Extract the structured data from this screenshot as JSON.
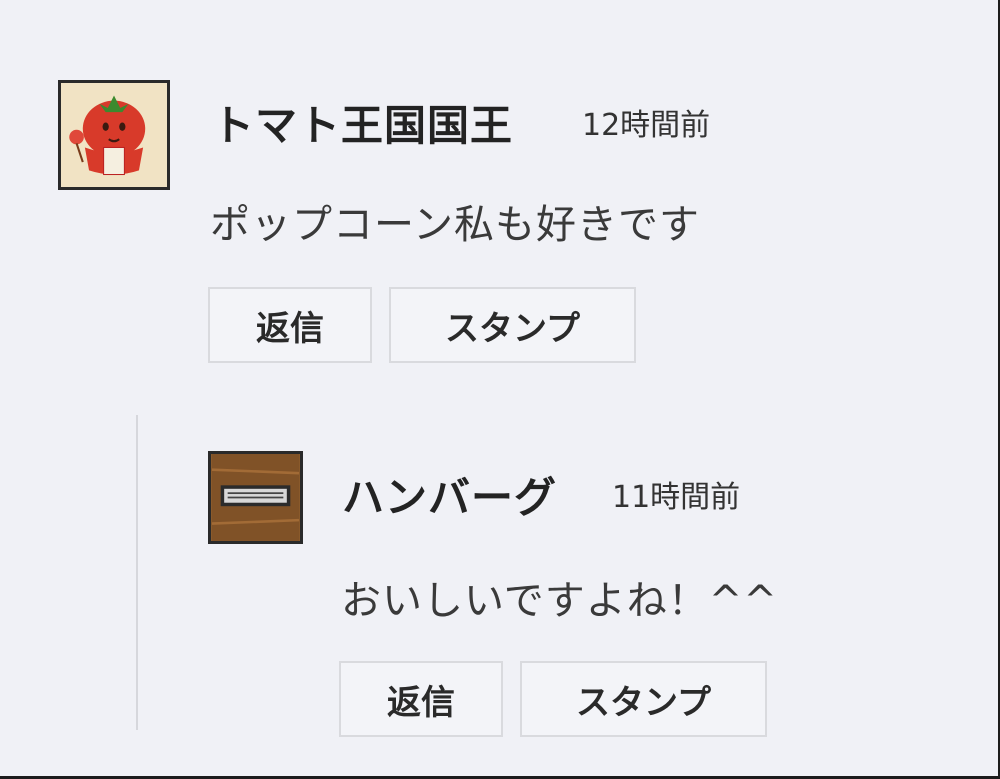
{
  "comments": [
    {
      "author": "トマト王国国王",
      "time": "12時間前",
      "text": "ポップコーン私も好きです",
      "avatar_icon": "tomato-icon",
      "reply_label": "返信",
      "stamp_label": "スタンプ"
    },
    {
      "author": "ハンバーグ",
      "time": "11時間前",
      "text": "おいしいですよね！^^",
      "avatar_icon": "wood-plaque-icon",
      "reply_label": "返信",
      "stamp_label": "スタンプ"
    }
  ],
  "colors": {
    "background": "#f0f1f6",
    "button_border": "#d9dade",
    "tomato_red": "#d83a2a",
    "wood_brown": "#8a5a2b"
  }
}
